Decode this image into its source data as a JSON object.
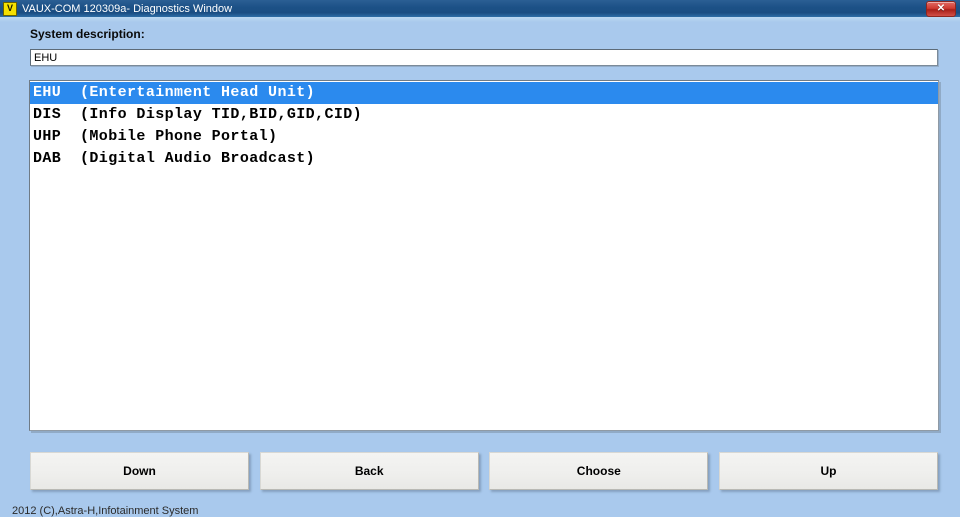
{
  "window": {
    "title": "VAUX-COM 120309a- Diagnostics Window",
    "app_icon_letter": "V",
    "close_label": "✕",
    "titlebar_color": "#1d5287",
    "background_color": "#a9c9ed"
  },
  "form": {
    "description_label": "System description:",
    "description_value": "EHU",
    "description_placeholder": ""
  },
  "list": {
    "selected_index": 0,
    "selection_color": "#2b8aee",
    "items": [
      {
        "label": "EHU  (Entertainment Head Unit)"
      },
      {
        "label": "DIS  (Info Display TID,BID,GID,CID)"
      },
      {
        "label": "UHP  (Mobile Phone Portal)"
      },
      {
        "label": "DAB  (Digital Audio Broadcast)"
      }
    ]
  },
  "buttons": {
    "down": "Down",
    "back": "Back",
    "choose": "Choose",
    "up": "Up"
  },
  "status": {
    "text": "2012 (C),Astra-H,Infotainment System"
  }
}
